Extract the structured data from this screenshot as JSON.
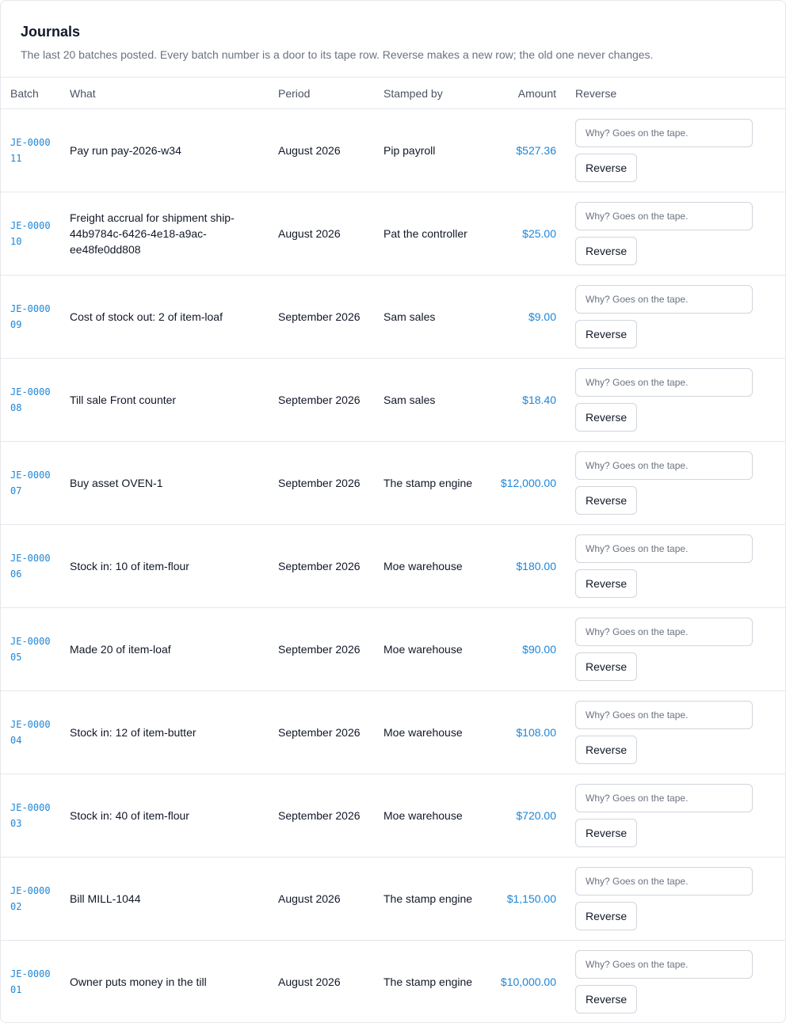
{
  "page": {
    "title": "Journals",
    "subtitle": "The last 20 batches posted. Every batch number is a door to its tape row. Reverse makes a new row; the old one never changes."
  },
  "table": {
    "columns": {
      "batch": "Batch",
      "what": "What",
      "period": "Period",
      "stamped_by": "Stamped by",
      "amount": "Amount",
      "reverse": "Reverse"
    },
    "reason_placeholder": "Why? Goes on the tape.",
    "reverse_label": "Reverse",
    "rows": [
      {
        "batch": "JE-000011",
        "what": "Pay run pay-2026-w34",
        "period": "August 2026",
        "stamped_by": "Pip payroll",
        "amount": "$527.36"
      },
      {
        "batch": "JE-000010",
        "what": "Freight accrual for shipment ship-44b9784c-6426-4e18-a9ac-ee48fe0dd808",
        "period": "August 2026",
        "stamped_by": "Pat the controller",
        "amount": "$25.00"
      },
      {
        "batch": "JE-000009",
        "what": "Cost of stock out: 2 of item-loaf",
        "period": "September 2026",
        "stamped_by": "Sam sales",
        "amount": "$9.00"
      },
      {
        "batch": "JE-000008",
        "what": "Till sale Front counter",
        "period": "September 2026",
        "stamped_by": "Sam sales",
        "amount": "$18.40"
      },
      {
        "batch": "JE-000007",
        "what": "Buy asset OVEN-1",
        "period": "September 2026",
        "stamped_by": "The stamp engine",
        "amount": "$12,000.00"
      },
      {
        "batch": "JE-000006",
        "what": "Stock in: 10 of item-flour",
        "period": "September 2026",
        "stamped_by": "Moe warehouse",
        "amount": "$180.00"
      },
      {
        "batch": "JE-000005",
        "what": "Made 20 of item-loaf",
        "period": "September 2026",
        "stamped_by": "Moe warehouse",
        "amount": "$90.00"
      },
      {
        "batch": "JE-000004",
        "what": "Stock in: 12 of item-butter",
        "period": "September 2026",
        "stamped_by": "Moe warehouse",
        "amount": "$108.00"
      },
      {
        "batch": "JE-000003",
        "what": "Stock in: 40 of item-flour",
        "period": "September 2026",
        "stamped_by": "Moe warehouse",
        "amount": "$720.00"
      },
      {
        "batch": "JE-000002",
        "what": "Bill MILL-1044",
        "period": "August 2026",
        "stamped_by": "The stamp engine",
        "amount": "$1,150.00"
      },
      {
        "batch": "JE-000001",
        "what": "Owner puts money in the till",
        "period": "August 2026",
        "stamped_by": "The stamp engine",
        "amount": "$10,000.00"
      }
    ]
  },
  "colors": {
    "link": "#1d86d8",
    "border": "#e5e7eb",
    "muted_text": "#6b7280"
  }
}
